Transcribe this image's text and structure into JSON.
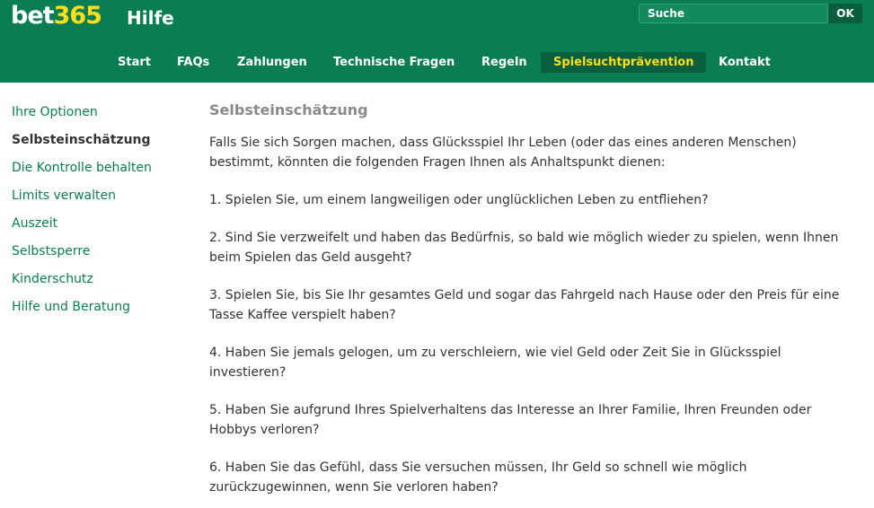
{
  "header": {
    "logo_part1": "bet",
    "logo_part2": "365",
    "section_title": "Hilfe",
    "search_placeholder": "Suche",
    "ok_label": "OK"
  },
  "nav": {
    "items": [
      "Start",
      "FAQs",
      "Zahlungen",
      "Technische Fragen",
      "Regeln",
      "Spielsuchtprävention",
      "Kontakt"
    ],
    "active": "Spielsuchtprävention"
  },
  "sidebar": {
    "items": [
      "Ihre Optionen",
      "Selbsteinschätzung",
      "Die Kontrolle behalten",
      "Limits verwalten",
      "Auszeit",
      "Selbstsperre",
      "Kinderschutz",
      "Hilfe und Beratung"
    ],
    "active": "Selbsteinschätzung"
  },
  "content": {
    "title": "Selbsteinschätzung",
    "intro": "Falls Sie sich Sorgen machen, dass Glücksspiel Ihr Leben (oder das eines anderen Menschen) bestimmt, könnten die folgenden Fragen Ihnen als Anhaltspunkt dienen:",
    "questions": [
      "1. Spielen Sie, um einem langweiligen oder unglücklichen Leben zu entfliehen?",
      "2. Sind Sie verzweifelt und haben das Bedürfnis, so bald wie möglich wieder zu spielen, wenn Ihnen beim Spielen das Geld ausgeht?",
      "3. Spielen Sie, bis Sie Ihr gesamtes Geld und sogar das Fahrgeld nach Hause oder den Preis für eine Tasse Kaffee verspielt haben?",
      "4. Haben Sie jemals gelogen, um zu verschleiern, wie viel Geld oder Zeit Sie in Glücksspiel investieren?",
      "5. Haben Sie aufgrund Ihres Spielverhaltens das Interesse an Ihrer Familie, Ihren Freunden oder Hobbys verloren?",
      "6. Haben Sie das Gefühl, dass Sie versuchen müssen, Ihr Geld so schnell wie möglich zurückzugewinnen, wenn Sie verloren haben?"
    ]
  },
  "colors": {
    "brand_green": "#0b7d52",
    "active_nav_bg": "#0a5f3f",
    "logo_yellow": "#ffdf1b",
    "link_green": "#0b7d52"
  }
}
